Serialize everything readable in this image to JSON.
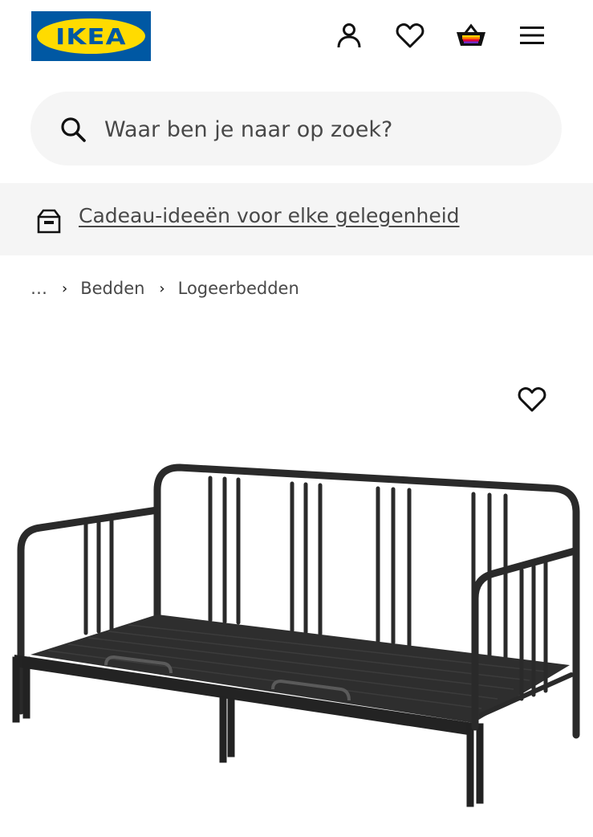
{
  "header": {
    "logo_text": "IKEA",
    "icons": [
      "user-icon",
      "heart-icon",
      "basket-icon",
      "menu-icon"
    ]
  },
  "search": {
    "placeholder": "Waar ben je naar op zoek?"
  },
  "promo": {
    "icon": "gift-box-icon",
    "link_text": "Cadeau-ideeën voor elke gelegenheid"
  },
  "breadcrumb": {
    "ellipsis": "…",
    "items": [
      "Bedden",
      "Logeerbedden"
    ]
  },
  "product": {
    "image": "black metal daybed frame",
    "favourite_icon": "heart-icon"
  },
  "colors": {
    "brand_blue": "#0058a3",
    "brand_yellow": "#ffdb00",
    "surface_grey": "#f5f5f5",
    "text_grey": "#484848"
  }
}
